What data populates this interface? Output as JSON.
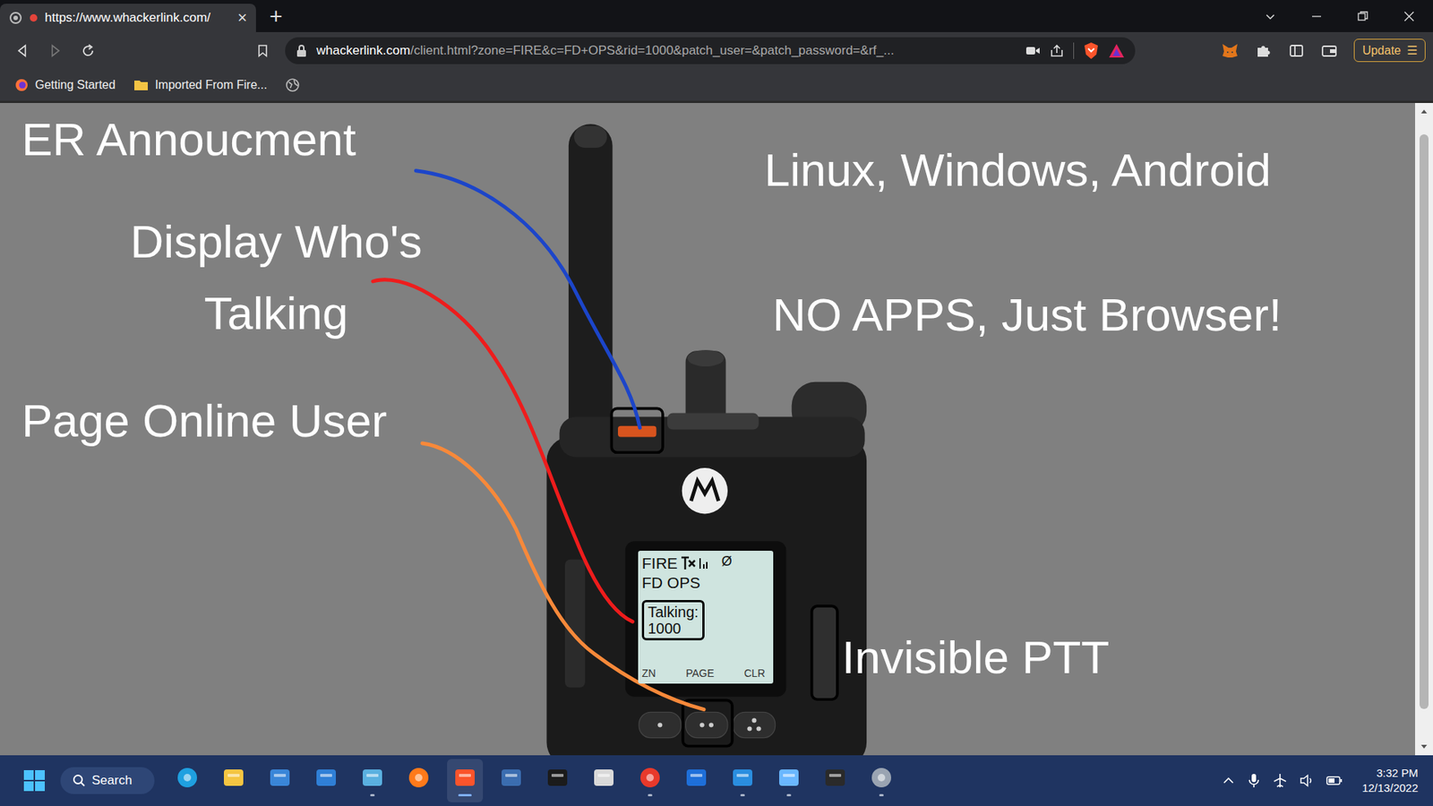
{
  "browser": {
    "tab": {
      "title": "https://www.whackerlink.com/",
      "close": "×",
      "selected": true
    },
    "new_tab": "+",
    "url": {
      "host": "whackerlink.com",
      "path": "/client.html?zone=FIRE&c=FD+OPS&rid=1000&patch_user=&patch_password=&rf_..."
    },
    "update_button": {
      "label": "Update",
      "menu": "☰"
    },
    "bookmarks": [
      {
        "label": "Getting Started",
        "kind": "firefox"
      },
      {
        "label": "Imported From Fire...",
        "kind": "folder"
      }
    ]
  },
  "annotations": [
    {
      "text": "ER Annoucment",
      "color": "#1c45c9"
    },
    {
      "text": "Display Who's Talking",
      "color": "#ee1c1c"
    },
    {
      "text": "Page Online User",
      "color": "#f7893a"
    },
    {
      "text": "Linux, Windows, Android"
    },
    {
      "text": "NO APPS, Just Browser!"
    },
    {
      "text": "Invisible PTT"
    }
  ],
  "radio_display": {
    "zone": "FIRE",
    "channel": "FD OPS",
    "talking_label": "Talking:",
    "talking_id": "1000",
    "status_glyph": "Ø",
    "softkeys": [
      "ZN",
      "PAGE",
      "CLR"
    ]
  },
  "taskbar": {
    "search": "Search",
    "apps": [
      {
        "kind": "edge",
        "running": false,
        "selected": false
      },
      {
        "kind": "explorer",
        "running": false,
        "selected": false
      },
      {
        "kind": "store",
        "running": false,
        "selected": false
      },
      {
        "kind": "mail",
        "running": false,
        "selected": false
      },
      {
        "kind": "paint",
        "running": true,
        "selected": false
      },
      {
        "kind": "firefox",
        "running": false,
        "selected": false
      },
      {
        "kind": "brave",
        "running": true,
        "selected": true
      },
      {
        "kind": "monitor",
        "running": false,
        "selected": false
      },
      {
        "kind": "terminal",
        "running": false,
        "selected": false
      },
      {
        "kind": "tower",
        "running": false,
        "selected": false
      },
      {
        "kind": "app",
        "running": true,
        "selected": false
      },
      {
        "kind": "remote",
        "running": false,
        "selected": false
      },
      {
        "kind": "vscode",
        "running": true,
        "selected": false
      },
      {
        "kind": "network",
        "running": true,
        "selected": false
      },
      {
        "kind": "console",
        "running": false,
        "selected": false
      },
      {
        "kind": "settings",
        "running": true,
        "selected": false
      }
    ],
    "time": "3:32 PM",
    "date": "12/13/2022"
  }
}
